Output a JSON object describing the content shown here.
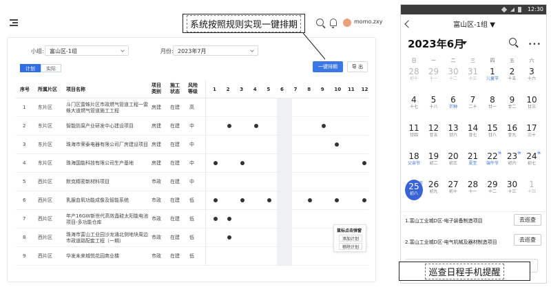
{
  "desktop": {
    "header": {
      "user_name": "momo.zxy"
    },
    "callout": "系统按照规则实现一键排期",
    "filters": {
      "group_label": "小组:",
      "group_value": "富山区-1组",
      "month_label": "月份:",
      "month_value": "2023年7月"
    },
    "tabs": [
      {
        "label": "计划",
        "active": true
      },
      {
        "label": "实际",
        "active": false
      }
    ],
    "buttons": {
      "one_click": "一键排期",
      "export": "导 出"
    },
    "table": {
      "headers": {
        "index": "序号",
        "district": "所属片区",
        "project": "项目名称",
        "type": "项目类别",
        "status": "施工状态",
        "risk": "风险等级"
      },
      "months": [
        "1",
        "2",
        "3",
        "4",
        "5",
        "6",
        "7",
        "8",
        "9",
        "10",
        "11",
        "12"
      ],
      "rows": [
        {
          "index": "1",
          "district": "东片区",
          "project": "斗门区雷蛛片区市政燃气管道工程一雷蛛大道燃气管道施工工程",
          "type": "房建",
          "status": "在建",
          "risk": "高",
          "dots": []
        },
        {
          "index": "2",
          "district": "东片区",
          "project": "智能防腐产业研发中心建设项目",
          "type": "房建",
          "status": "在建",
          "risk": "中",
          "dots": [
            2,
            4,
            9
          ]
        },
        {
          "index": "3",
          "district": "东片区",
          "project": "珠海市荣泰电器有限公司厂房建设项目",
          "type": "房建",
          "status": "在建",
          "risk": "中",
          "dots": [
            10
          ]
        },
        {
          "index": "4",
          "district": "东片区",
          "project": "珠海国能科技有限公司生产基地",
          "type": "房建",
          "status": "在建",
          "risk": "中",
          "dots": [
            1,
            3,
            12
          ]
        },
        {
          "index": "5",
          "district": "西片区",
          "project": "默克精密新材料项目",
          "type": "市政",
          "status": "在建",
          "risk": "中",
          "dots": []
        },
        {
          "index": "6",
          "district": "西片区",
          "project": "乳腺血氧功能成像及智能系统",
          "type": "市政",
          "status": "在建",
          "risk": "低",
          "dots": [
            1,
            3,
            5,
            8,
            10,
            12
          ]
        },
        {
          "index": "7",
          "district": "西片区",
          "project": "年产16GW新世代高效晶硅太阳能电池项目-多功能仓库",
          "type": "市政",
          "status": "在建",
          "risk": "低",
          "dots": [
            1,
            2
          ]
        },
        {
          "index": "8",
          "district": "西片区",
          "project": "珠海市富山工业园沙龙涌北侧地块周边市政道路配套工程（一期）",
          "type": "市政",
          "status": "在建",
          "risk": "低",
          "dots": [
            2
          ]
        },
        {
          "index": "9",
          "district": "西片区",
          "project": "华发未来城悦花园商业楼",
          "type": "市政",
          "status": "在建",
          "risk": "低",
          "dots": []
        }
      ]
    },
    "popup": {
      "title": "鼠标点击弹窗",
      "add": "添加计划",
      "remove": "移除计划"
    }
  },
  "phone": {
    "status_time": "12:30",
    "title": "富山区-1组 ▼",
    "month": "2023年6月",
    "weekdays": [
      "日",
      "一",
      "二",
      "三",
      "四",
      "五",
      "六"
    ],
    "weeks": [
      [
        {
          "n": "28",
          "s": "初十",
          "dim": true
        },
        {
          "n": "29",
          "s": "十一",
          "dim": true
        },
        {
          "n": "30",
          "s": "十二",
          "dim": true
        },
        {
          "n": "31",
          "s": "十三",
          "dim": true
        },
        {
          "n": "1",
          "s": "儿童节",
          "hol": true
        },
        {
          "n": "2",
          "s": "十五"
        },
        {
          "n": "3",
          "s": "十六"
        }
      ],
      [
        {
          "n": "4",
          "s": "十七"
        },
        {
          "n": "5",
          "s": "十八"
        },
        {
          "n": "6",
          "s": "芒种",
          "hol": true
        },
        {
          "n": "7",
          "s": "二十"
        },
        {
          "n": "8",
          "s": "廿一"
        },
        {
          "n": "9",
          "s": "廿二"
        },
        {
          "n": "10",
          "s": "廿三"
        }
      ],
      [
        {
          "n": "11",
          "s": "廿四"
        },
        {
          "n": "12",
          "s": "廿五"
        },
        {
          "n": "13",
          "s": "廿六"
        },
        {
          "n": "14",
          "s": "廿七"
        },
        {
          "n": "15",
          "s": "廿八"
        },
        {
          "n": "16",
          "s": "廿九"
        },
        {
          "n": "17",
          "s": "三十"
        }
      ],
      [
        {
          "n": "18",
          "s": "父亲节",
          "hol": true
        },
        {
          "n": "19",
          "s": "初二"
        },
        {
          "n": "20",
          "s": "初三"
        },
        {
          "n": "21",
          "s": "夏至",
          "hol": true
        },
        {
          "n": "22",
          "s": "端午节",
          "hol": true,
          "badge": "休"
        },
        {
          "n": "23",
          "s": "初六",
          "badge": "休"
        },
        {
          "n": "24",
          "s": "初七",
          "badge": "休"
        }
      ],
      [
        {
          "n": "25",
          "s": "初八",
          "today": true,
          "badge": "班"
        },
        {
          "n": "26",
          "s": "初九"
        },
        {
          "n": "27",
          "s": "初十"
        },
        {
          "n": "28",
          "s": "十一"
        },
        {
          "n": "29",
          "s": "十二"
        },
        {
          "n": "30",
          "s": "十三"
        },
        {
          "n": "1",
          "s": "十四",
          "dim": true
        }
      ]
    ],
    "tasks": [
      {
        "label": "1.富山工业城D区-电子装备制造项目",
        "button": "去巡查"
      },
      {
        "label": "2.富山工业城D区-电气机械及器材制造项目",
        "button": "去巡查"
      }
    ],
    "callout": "巡查日程手机提醒"
  },
  "colors": {
    "primary": "#3a78e8",
    "today": "#3a63d8",
    "holiday": "#3a6fd8"
  }
}
